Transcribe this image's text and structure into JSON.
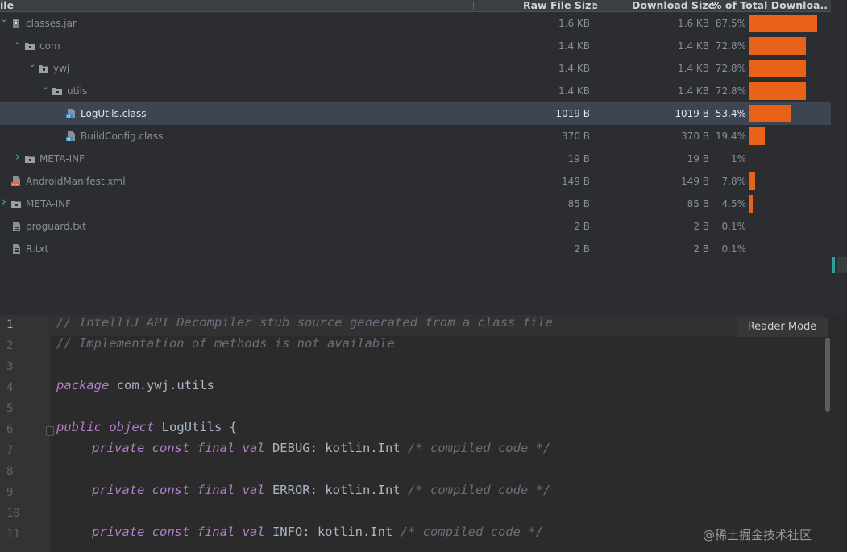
{
  "header": {
    "col_file": "ile",
    "col_raw": "Raw File Size",
    "col_download": "Download Size",
    "col_percent": "% of Total Downloa..."
  },
  "rows": [
    {
      "name": "classes.jar",
      "raw": "1.6 KB",
      "dl": "1.6 KB",
      "pct": "87.5%",
      "fraction": 0.875,
      "chevron": "expanded",
      "icon": "jar-icon"
    },
    {
      "name": "com",
      "raw": "1.4 KB",
      "dl": "1.4 KB",
      "pct": "72.8%",
      "fraction": 0.728,
      "chevron": "expanded",
      "icon": "folder-icon"
    },
    {
      "name": "ywj",
      "raw": "1.4 KB",
      "dl": "1.4 KB",
      "pct": "72.8%",
      "fraction": 0.728,
      "chevron": "expanded",
      "icon": "folder-icon"
    },
    {
      "name": "utils",
      "raw": "1.4 KB",
      "dl": "1.4 KB",
      "pct": "72.8%",
      "fraction": 0.728,
      "chevron": "expanded",
      "icon": "folder-icon"
    },
    {
      "name": "LogUtils.class",
      "raw": "1019 B",
      "dl": "1019 B",
      "pct": "53.4%",
      "fraction": 0.534,
      "chevron": "none",
      "icon": "class-file-icon",
      "selected": true
    },
    {
      "name": "BuildConfig.class",
      "raw": "370 B",
      "dl": "370 B",
      "pct": "19.4%",
      "fraction": 0.194,
      "chevron": "none",
      "icon": "class-file-icon"
    },
    {
      "name": "META-INF",
      "raw": "19 B",
      "dl": "19 B",
      "pct": "1%",
      "fraction": 0.01,
      "chevron": "collapsed",
      "icon": "folder-icon"
    },
    {
      "name": "AndroidManifest.xml",
      "raw": "149 B",
      "dl": "149 B",
      "pct": "7.8%",
      "fraction": 0.078,
      "chevron": "none",
      "icon": "xml-file-icon"
    },
    {
      "name": "META-INF",
      "raw": "85 B",
      "dl": "85 B",
      "pct": "4.5%",
      "fraction": 0.045,
      "chevron": "collapsed",
      "icon": "folder-icon"
    },
    {
      "name": "proguard.txt",
      "raw": "2 B",
      "dl": "2 B",
      "pct": "0.1%",
      "fraction": 0.001,
      "chevron": "none",
      "icon": "text-file-icon"
    },
    {
      "name": "R.txt",
      "raw": "2 B",
      "dl": "2 B",
      "pct": "0.1%",
      "fraction": 0.001,
      "chevron": "none",
      "icon": "text-file-icon"
    }
  ],
  "editor": {
    "reader_mode_label": "Reader Mode",
    "current_line": 1,
    "line_numbers": [
      "1",
      "2",
      "3",
      "4",
      "5",
      "6",
      "7",
      "8",
      "9",
      "10",
      "11"
    ],
    "lines": {
      "l1": "// IntelliJ API Decompiler stub source generated from a class file",
      "l2": "// Implementation of methods is not available",
      "l4_kw": "package",
      "l4_rest": " com.ywj.utils",
      "l6_kw": "public object",
      "l6_rest": " LogUtils {",
      "l7_kw": "private const final val",
      "l7_rest": " DEBUG: kotlin.Int ",
      "l7_cm": "/* compiled code */",
      "l9_kw": "private const final val",
      "l9_rest": " ERROR: kotlin.Int ",
      "l9_cm": "/* compiled code */",
      "l11_kw": "private const final val",
      "l11_rest": " INFO: kotlin.Int ",
      "l11_cm": "/* compiled code */"
    }
  },
  "watermark": "@稀土掘金技术社区",
  "colors": {
    "accent": "#e8621a",
    "chevron": "#4fb3a9",
    "selection": "#3c4551"
  }
}
